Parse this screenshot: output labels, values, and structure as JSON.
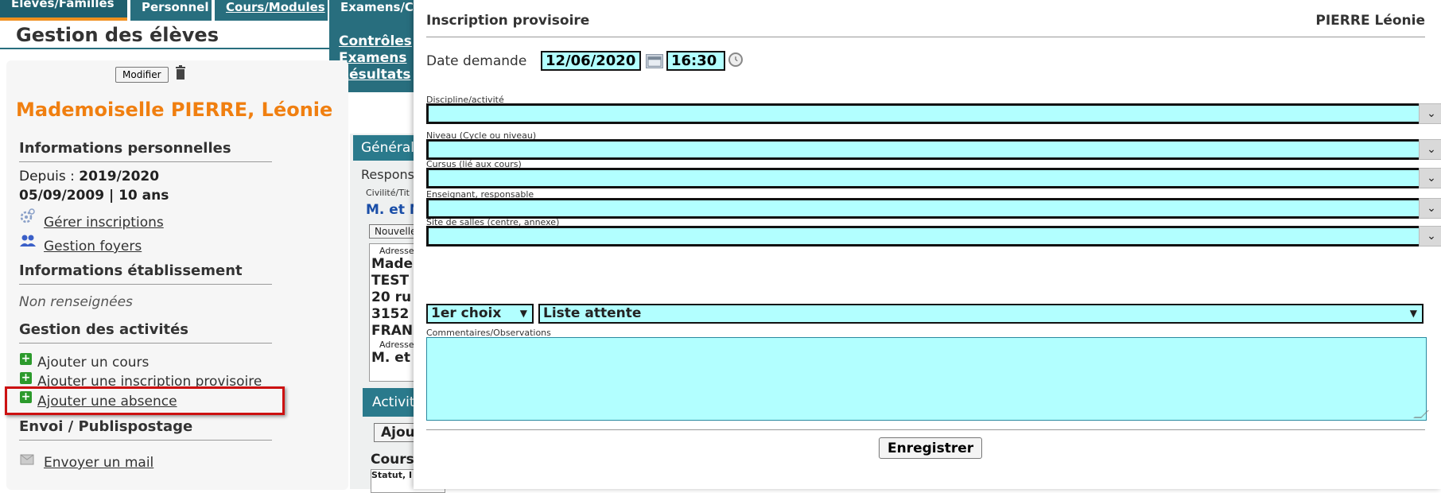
{
  "tabs": {
    "eleves": "Elèves/Familles",
    "personnel": "Personnel",
    "cours": "Cours/Modules",
    "examens": "Examens/Co"
  },
  "submenu": [
    "Contrôles",
    "Examens",
    "Résultats"
  ],
  "page_title": "Gestion des élèves",
  "modify_label": "Modifier",
  "student": {
    "name": "Mademoiselle PIERRE, Léonie",
    "since_label": "Depuis :",
    "since_value": "2019/2020",
    "birth": "05/09/2009 | 10 ans"
  },
  "sections": {
    "perso": "Informations personnelles",
    "etab": "Informations établissement",
    "activites": "Gestion des activités",
    "envoi": "Envoi / Publispostage"
  },
  "links": {
    "gerer": "Gérer inscriptions",
    "foyers": "Gestion foyers",
    "non_renseignees": "Non renseignées",
    "ajouter_cours": "Ajouter un cours",
    "ajouter_inscription": "Ajouter une inscription provisoire",
    "ajouter_absence": "Ajouter une absence",
    "envoyer_mail": "Envoyer un mail"
  },
  "middle": {
    "general_tab": "Général",
    "respons": "Respons",
    "civilite": "Civilité/Tit",
    "mr": "M. et M",
    "nouvelle": "Nouvelle",
    "addr_label": "Adresse",
    "addr_lines": [
      "Made",
      "TEST",
      "20 ru",
      "3152",
      "FRAN"
    ],
    "addr_label2": "Adresse",
    "addr_line2": "M. et",
    "activit_tab": "Activit",
    "ajou": "Ajou",
    "cours": "Cours",
    "statut": "Statut, I"
  },
  "dialog": {
    "title": "Inscription provisoire",
    "student": "PIERRE Léonie",
    "date_label": "Date demande",
    "date_value": "12/06/2020",
    "time_value": "16:30",
    "fields": {
      "discipline": "Discipline/activité",
      "niveau": "Niveau (Cycle ou niveau)",
      "cursus": "Cursus (lié aux cours)",
      "enseignant": "Enseignant, responsable",
      "site": "Site de salles (centre, annexe)"
    },
    "choice_value": "1er choix",
    "list_value": "Liste attente",
    "comments_label": "Commentaires/Observations",
    "save_label": "Enregistrer"
  },
  "colors": {
    "accent_orange": "#f07f10",
    "nav_teal": "#286e7e",
    "field_cyan": "#b2ffff",
    "highlight_red": "#cc1111"
  }
}
